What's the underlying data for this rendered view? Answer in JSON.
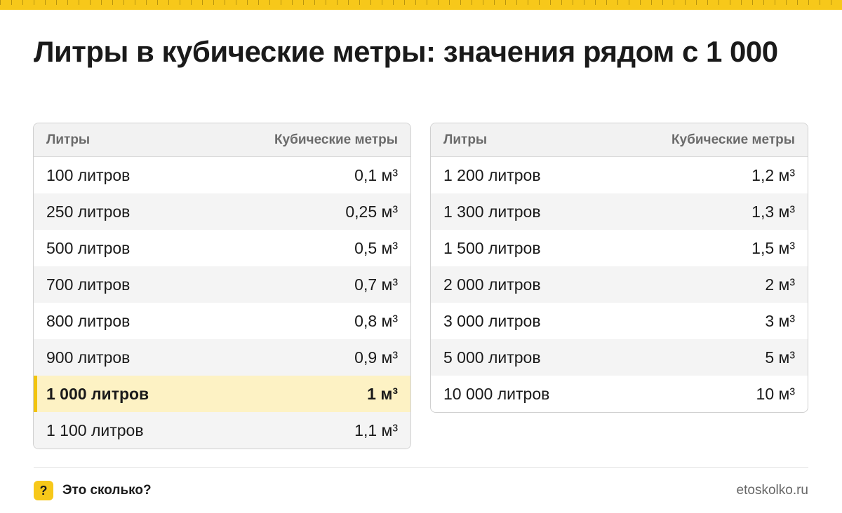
{
  "title": "Литры в кубические метры: значения рядом с 1 000",
  "left_table": {
    "col1": "Литры",
    "col2": "Кубические метры",
    "rows": [
      {
        "liters": "100 литров",
        "m3": "0,1 м³"
      },
      {
        "liters": "250 литров",
        "m3": "0,25 м³"
      },
      {
        "liters": "500 литров",
        "m3": "0,5 м³"
      },
      {
        "liters": "700 литров",
        "m3": "0,7 м³"
      },
      {
        "liters": "800 литров",
        "m3": "0,8 м³"
      },
      {
        "liters": "900 литров",
        "m3": "0,9 м³"
      },
      {
        "liters": "1 000 литров",
        "m3": "1 м³"
      },
      {
        "liters": "1 100 литров",
        "m3": "1,1 м³"
      }
    ]
  },
  "right_table": {
    "col1": "Литры",
    "col2": "Кубические метры",
    "rows": [
      {
        "liters": "1 200 литров",
        "m3": "1,2 м³"
      },
      {
        "liters": "1 300 литров",
        "m3": "1,3 м³"
      },
      {
        "liters": "1 500 литров",
        "m3": "1,5 м³"
      },
      {
        "liters": "2 000 литров",
        "m3": "2 м³"
      },
      {
        "liters": "3 000 литров",
        "m3": "3 м³"
      },
      {
        "liters": "5 000 литров",
        "m3": "5 м³"
      },
      {
        "liters": "10 000 литров",
        "m3": "10 м³"
      }
    ]
  },
  "footer": {
    "brand_icon": "?",
    "brand_name": "Это сколько?",
    "site": "etoskolko.ru"
  },
  "colors": {
    "accent": "#f7c81a",
    "highlight": "#fdf2c4"
  }
}
